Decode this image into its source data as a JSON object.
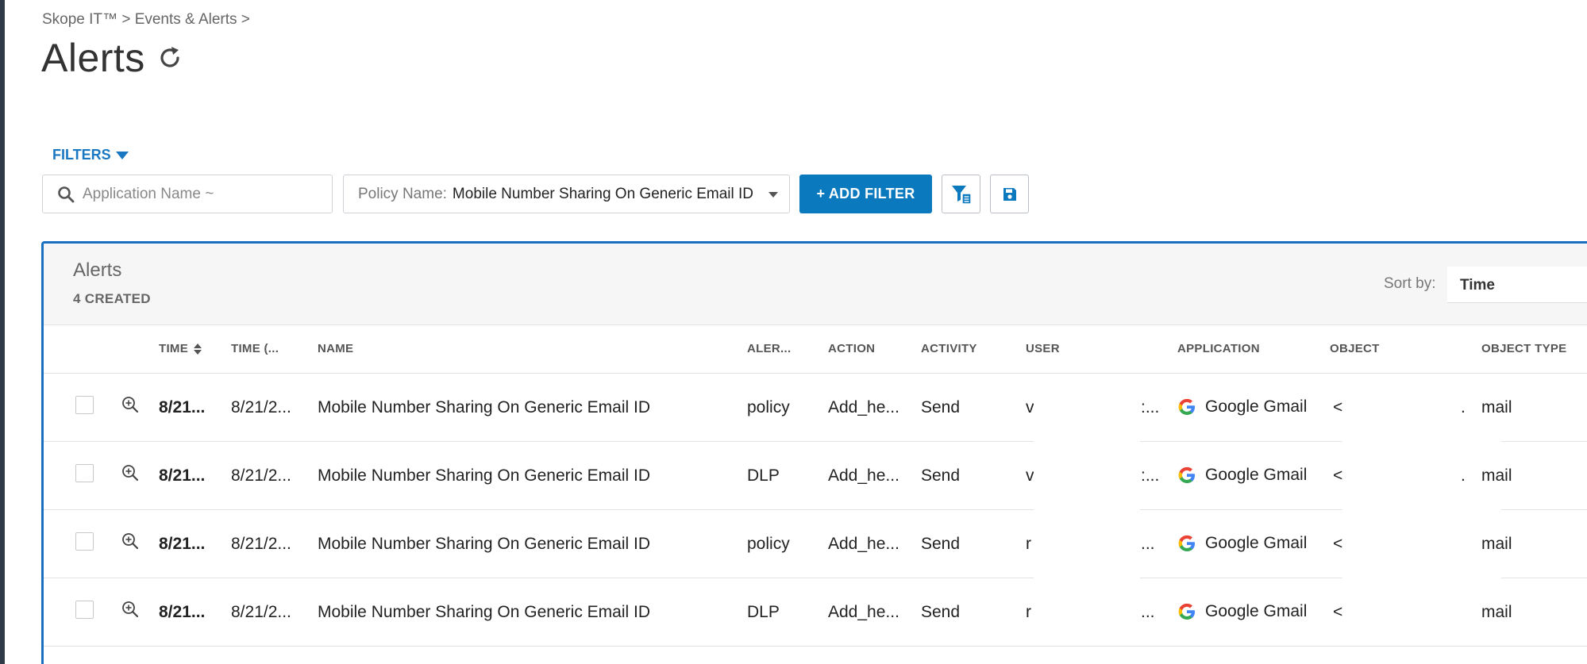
{
  "breadcrumb": "Skope IT™ > Events & Alerts >",
  "page": {
    "title": "Alerts"
  },
  "filters": {
    "toggle_label": "FILTERS",
    "search_placeholder": "Application Name ~",
    "policy_label": "Policy Name:",
    "policy_value": "Mobile Number Sharing On Generic Email ID",
    "add_filter_label": "+ ADD FILTER"
  },
  "panel": {
    "title": "Alerts",
    "count_label": "4 CREATED",
    "sort_label": "Sort by:",
    "sort_value": "Time"
  },
  "table": {
    "columns": {
      "time": "TIME",
      "time2": "TIME (...",
      "name": "NAME",
      "alert": "ALER...",
      "action": "ACTION",
      "activity": "ACTIVITY",
      "user": "USER",
      "application": "APPLICATION",
      "object": "OBJECT",
      "object_type": "OBJECT TYPE"
    },
    "rows": [
      {
        "time": "8/21...",
        "time2": "8/21/2...",
        "name": "Mobile Number Sharing On Generic Email ID",
        "alert": "policy",
        "action": "Add_he...",
        "activity": "Send",
        "user_start": "v",
        "user_end": ":...",
        "application": "Google Gmail",
        "object_start": "<",
        "object_end": ".",
        "object_type": "mail"
      },
      {
        "time": "8/21...",
        "time2": "8/21/2...",
        "name": "Mobile Number Sharing On Generic Email ID",
        "alert": "DLP",
        "action": "Add_he...",
        "activity": "Send",
        "user_start": "v",
        "user_end": ":...",
        "application": "Google Gmail",
        "object_start": "<",
        "object_end": ".",
        "object_type": "mail"
      },
      {
        "time": "8/21...",
        "time2": "8/21/2...",
        "name": "Mobile Number Sharing On Generic Email ID",
        "alert": "policy",
        "action": "Add_he...",
        "activity": "Send",
        "user_start": "r",
        "user_end": "...",
        "application": "Google Gmail",
        "object_start": "<",
        "object_end": "",
        "object_type": "mail"
      },
      {
        "time": "8/21...",
        "time2": "8/21/2...",
        "name": "Mobile Number Sharing On Generic Email ID",
        "alert": "DLP",
        "action": "Add_he...",
        "activity": "Send",
        "user_start": "r",
        "user_end": "...",
        "application": "Google Gmail",
        "object_start": "<",
        "object_end": "",
        "object_type": "mail"
      }
    ]
  },
  "colors": {
    "accent": "#0a79be",
    "panel_border": "#1a6fc0",
    "link": "#1a78c2"
  }
}
